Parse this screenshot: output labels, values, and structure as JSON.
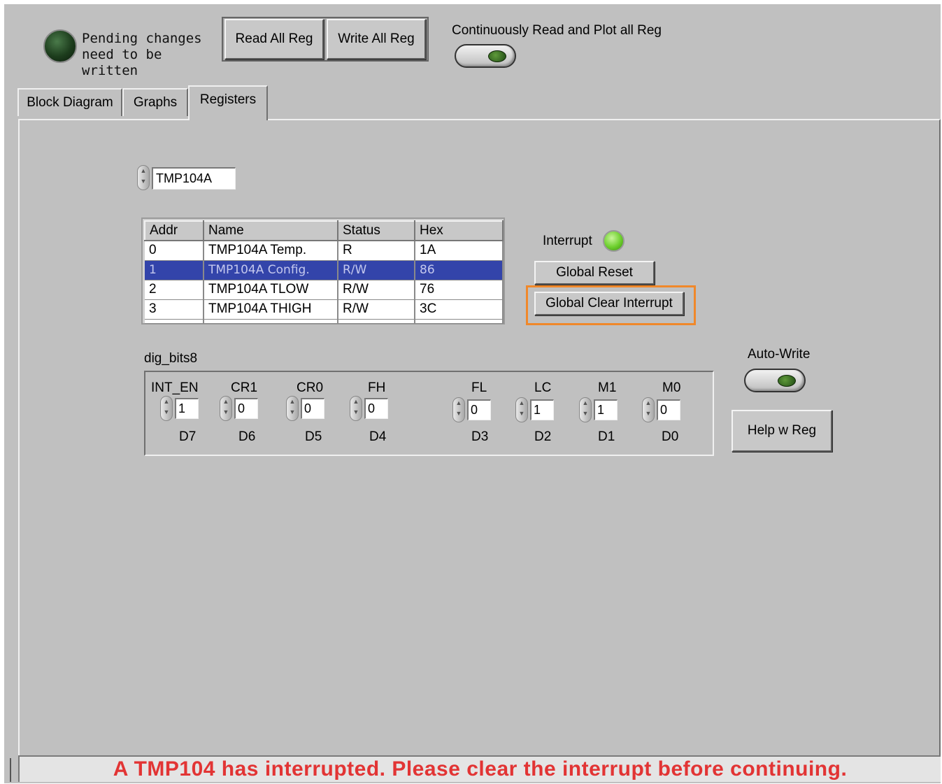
{
  "header": {
    "pending_text_line1": "Pending changes",
    "pending_text_line2": "need to be written",
    "read_all_label": "Read All Reg",
    "write_all_label": "Write All Reg",
    "continuous_label": "Continuously Read and Plot all Reg"
  },
  "tabs": [
    {
      "label": "Block Diagram"
    },
    {
      "label": "Graphs"
    },
    {
      "label": "Registers"
    }
  ],
  "device_select": {
    "value": "TMP104A"
  },
  "register_table": {
    "columns": [
      "Addr",
      "Name",
      "Status",
      "Hex"
    ],
    "rows": [
      {
        "addr": "0",
        "name": "TMP104A Temp.",
        "status": "R",
        "hex": "1A"
      },
      {
        "addr": "1",
        "name": "TMP104A Config.",
        "status": "R/W",
        "hex": "86"
      },
      {
        "addr": "2",
        "name": "TMP104A TLOW",
        "status": "R/W",
        "hex": "76"
      },
      {
        "addr": "3",
        "name": "TMP104A THIGH",
        "status": "R/W",
        "hex": "3C"
      }
    ],
    "selected_row": 1
  },
  "interrupt": {
    "label": "Interrupt",
    "led_color": "#6ccf2c",
    "global_reset_label": "Global Reset",
    "global_clear_label": "Global Clear Interrupt",
    "highlight_color": "#f0882a"
  },
  "dig_bits": {
    "label": "dig_bits8",
    "bits": [
      {
        "name": "INT_EN",
        "value": "1",
        "d": "D7"
      },
      {
        "name": "CR1",
        "value": "0",
        "d": "D6"
      },
      {
        "name": "CR0",
        "value": "0",
        "d": "D5"
      },
      {
        "name": "FH",
        "value": "0",
        "d": "D4"
      },
      {
        "name": "FL",
        "value": "0",
        "d": "D3"
      },
      {
        "name": "LC",
        "value": "1",
        "d": "D2"
      },
      {
        "name": "M1",
        "value": "1",
        "d": "D1"
      },
      {
        "name": "M0",
        "value": "0",
        "d": "D0"
      }
    ]
  },
  "auto_write": {
    "label": "Auto-Write"
  },
  "help_button": {
    "label": "Help w Reg"
  },
  "status": {
    "message": "A TMP104 has interrupted. Please clear the interrupt before continuing.",
    "color": "#e23434"
  }
}
